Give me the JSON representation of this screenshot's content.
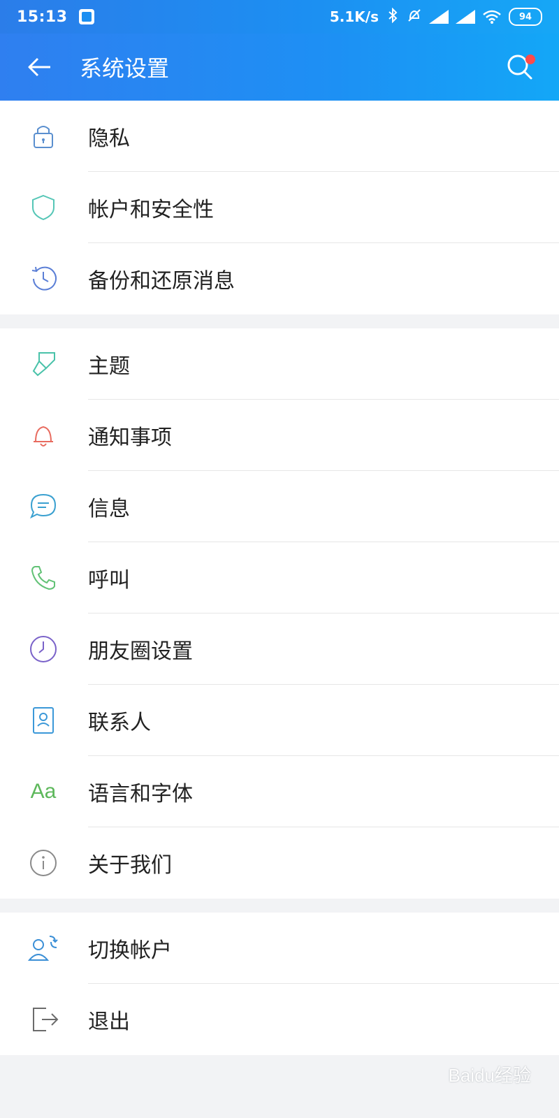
{
  "status_bar": {
    "time": "15:13",
    "speed": "5.1K/s",
    "battery": "94"
  },
  "header": {
    "title": "系统设置"
  },
  "sections": [
    {
      "items": [
        {
          "label": "隐私",
          "icon": "lock-icon",
          "color": "#5a8fcf"
        },
        {
          "label": "帐户和安全性",
          "icon": "shield-icon",
          "color": "#55c6b6"
        },
        {
          "label": "备份和还原消息",
          "icon": "history-icon",
          "color": "#5b7fd6"
        }
      ]
    },
    {
      "items": [
        {
          "label": "主题",
          "icon": "paint-brush-icon",
          "color": "#49c2a9"
        },
        {
          "label": "通知事项",
          "icon": "bell-icon",
          "color": "#e86b5f"
        },
        {
          "label": "信息",
          "icon": "chat-icon",
          "color": "#3aa0d0"
        },
        {
          "label": "呼叫",
          "icon": "phone-icon",
          "color": "#62c276"
        },
        {
          "label": "朋友圈设置",
          "icon": "clock-icon",
          "color": "#7a62c9"
        },
        {
          "label": "联系人",
          "icon": "contact-card-icon",
          "color": "#3b98d8"
        },
        {
          "label": "语言和字体",
          "icon": "font-icon",
          "color": "#5db85b"
        },
        {
          "label": "关于我们",
          "icon": "info-icon",
          "color": "#8a8a8a"
        }
      ]
    },
    {
      "items": [
        {
          "label": "切换帐户",
          "icon": "switch-account-icon",
          "color": "#3b8fd6"
        },
        {
          "label": "退出",
          "icon": "logout-icon",
          "color": "#6b6b6b"
        }
      ]
    }
  ],
  "watermark": "Baidu经验"
}
